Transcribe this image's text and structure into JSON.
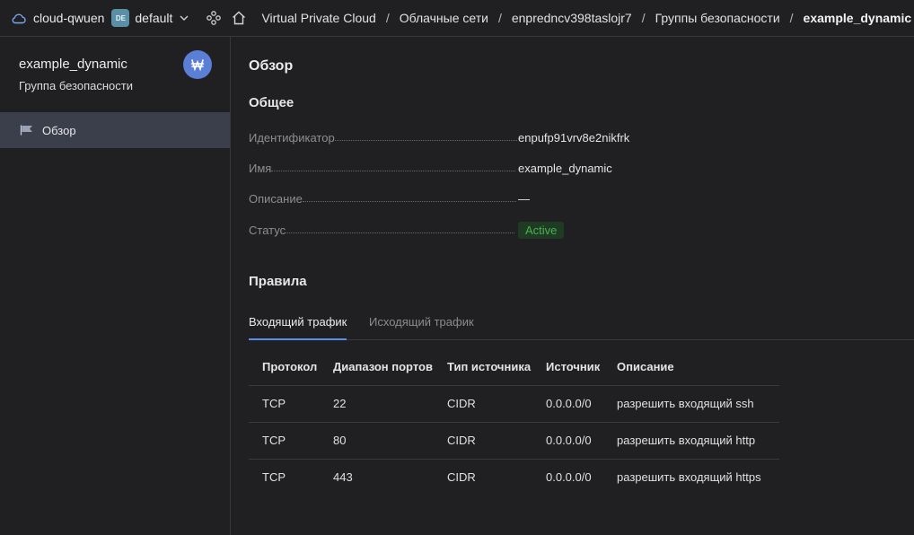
{
  "topbar": {
    "cloud_name": "cloud-qwuen",
    "folder_badge": "DE",
    "folder_name": "default",
    "breadcrumbs": [
      "Virtual Private Cloud",
      "Облачные сети",
      "enpredncv398taslojr7",
      "Группы безопасности",
      "example_dynamic"
    ],
    "separator": "/"
  },
  "sidebar": {
    "resource_title": "example_dynamic",
    "resource_subtitle": "Группа безопасности",
    "nav": [
      {
        "label": "Обзор",
        "icon": "flag-icon"
      }
    ]
  },
  "main": {
    "page_title": "Обзор",
    "general_title": "Общее",
    "properties": [
      {
        "key": "Идентификатор",
        "value": "enpufp91vrv8e2nikfrk"
      },
      {
        "key": "Имя",
        "value": "example_dynamic"
      },
      {
        "key": "Описание",
        "value": "—"
      },
      {
        "key": "Статус",
        "value": "Active"
      }
    ],
    "rules_title": "Правила",
    "tabs": [
      {
        "label": "Входящий трафик",
        "active": true
      },
      {
        "label": "Исходящий трафик",
        "active": false
      }
    ],
    "table": {
      "columns": [
        "Протокол",
        "Диапазон портов",
        "Тип источника",
        "Источник",
        "Описание"
      ],
      "rows": [
        [
          "TCP",
          "22",
          "CIDR",
          "0.0.0.0/0",
          "разрешить входящий ssh"
        ],
        [
          "TCP",
          "80",
          "CIDR",
          "0.0.0.0/0",
          "разрешить входящий http"
        ],
        [
          "TCP",
          "443",
          "CIDR",
          "0.0.0.0/0",
          "разрешить входящий https"
        ]
      ]
    }
  },
  "colors": {
    "background": "#202022",
    "nav_active": "#3a3f4b",
    "accent": "#5b8def",
    "status_green": "#4caf50",
    "avatar": "#5b7fd6"
  }
}
